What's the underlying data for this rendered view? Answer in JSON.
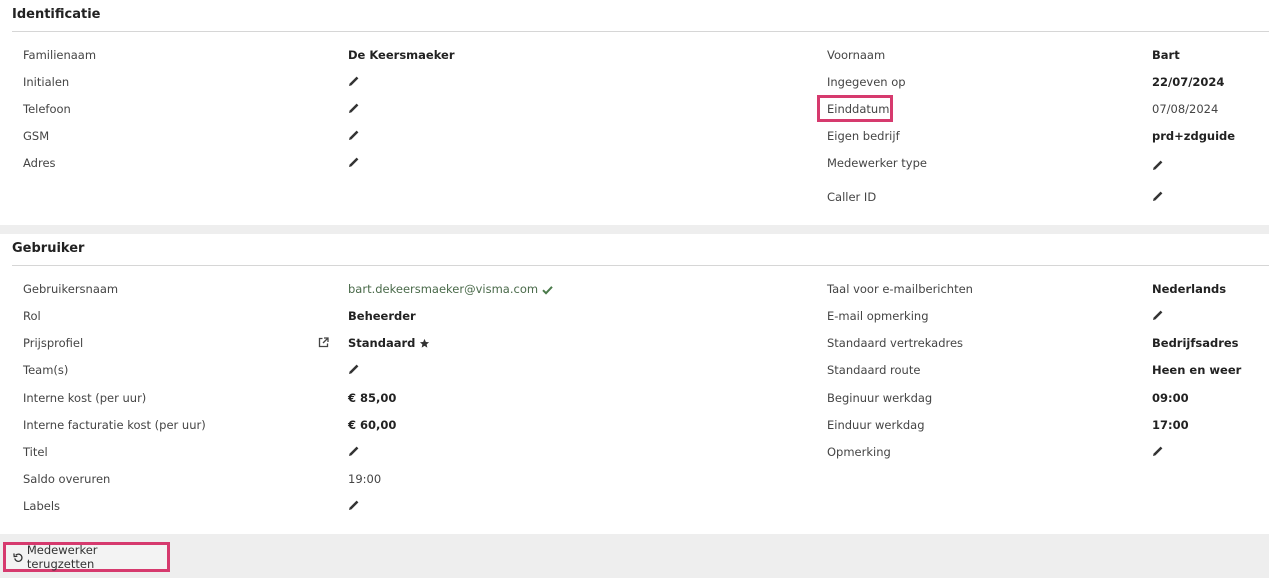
{
  "identificatie": {
    "title": "Identificatie",
    "familienaam_label": "Familienaam",
    "familienaam_value": "De Keersmaeker",
    "initialen_label": "Initialen",
    "telefoon_label": "Telefoon",
    "gsm_label": "GSM",
    "adres_label": "Adres",
    "voornaam_label": "Voornaam",
    "voornaam_value": "Bart",
    "ingegeven_label": "Ingegeven op",
    "ingegeven_value": "22/07/2024",
    "einddatum_label": "Einddatum",
    "einddatum_value": "07/08/2024",
    "bedrijf_label": "Eigen bedrijf",
    "bedrijf_value": "prd+zdguide",
    "medewerker_type_label": "Medewerker type",
    "caller_id_label": "Caller ID"
  },
  "gebruiker": {
    "title": "Gebruiker",
    "gebruikersnaam_label": "Gebruikersnaam",
    "gebruikersnaam_value": "bart.dekeersmaeker@visma.com",
    "rol_label": "Rol",
    "rol_value": "Beheerder",
    "prijsprofiel_label": "Prijsprofiel",
    "prijsprofiel_value": "Standaard",
    "teams_label": "Team(s)",
    "interne_kost_label": "Interne kost (per uur)",
    "interne_kost_value": "€ 85,00",
    "facturatie_kost_label": "Interne facturatie kost (per uur)",
    "facturatie_kost_value": "€ 60,00",
    "titel_label": "Titel",
    "saldo_label": "Saldo overuren",
    "saldo_value": "19:00",
    "labels_label": "Labels",
    "taal_label": "Taal voor e-mailberichten",
    "taal_value": "Nederlands",
    "email_opmerking_label": "E-mail opmerking",
    "vertrekadres_label": "Standaard vertrekadres",
    "vertrekadres_value": "Bedrijfsadres",
    "route_label": "Standaard route",
    "route_value": "Heen en weer",
    "beginuur_label": "Beginuur werkdag",
    "beginuur_value": "09:00",
    "einduur_label": "Einduur werkdag",
    "einduur_value": "17:00",
    "opmerking_label": "Opmerking"
  },
  "actions": {
    "reset_label": "Medewerker terugzetten"
  },
  "colors": {
    "highlight": "#d63a6e",
    "check": "#4a7a4a"
  }
}
